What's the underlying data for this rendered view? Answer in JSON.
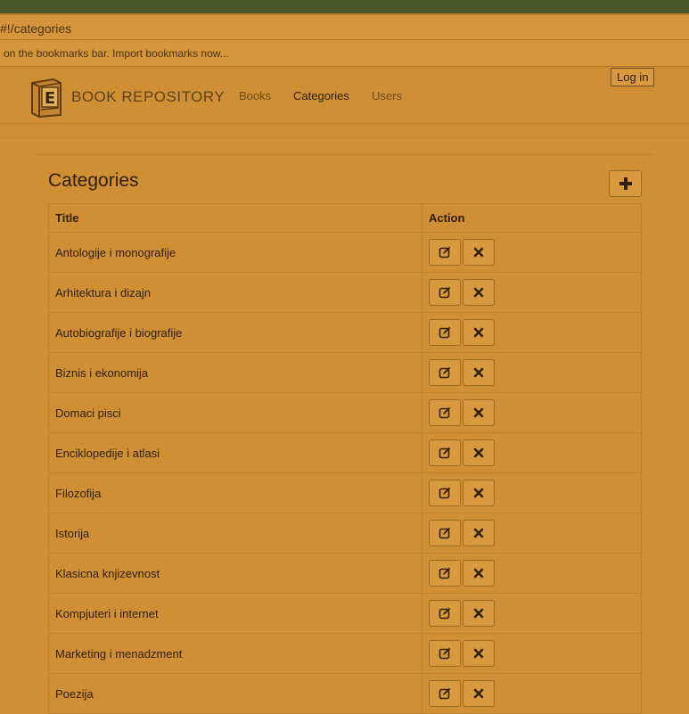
{
  "browser": {
    "url_fragment": "#!/categories",
    "bookmarks_message": "on the bookmarks bar. Import bookmarks now..."
  },
  "navbar": {
    "brand": "BOOK REPOSITORY",
    "links": [
      "Books",
      "Categories",
      "Users"
    ],
    "active_link": "Categories",
    "login_label": "Log in",
    "logo_letter": "E"
  },
  "page": {
    "title": "Categories",
    "add_button_icon": "plus-icon"
  },
  "table": {
    "headers": [
      "Title",
      "Action"
    ],
    "rows": [
      "Antologije i monografije",
      "Arhitektura i dizajn",
      "Autobiografije i biografije",
      "Biznis i ekonomija",
      "Domaci pisci",
      "Enciklopedije i atlasi",
      "Filozofija",
      "Istorija",
      "Klasicna knjizevnost",
      "Kompjuteri i internet",
      "Marketing i menadzment",
      "Poezija"
    ],
    "row_actions": [
      "edit-icon",
      "delete-icon"
    ]
  },
  "colors": {
    "page_background": "#d08f35",
    "top_strip": "#4a5a2a",
    "text": "#2f2110"
  }
}
